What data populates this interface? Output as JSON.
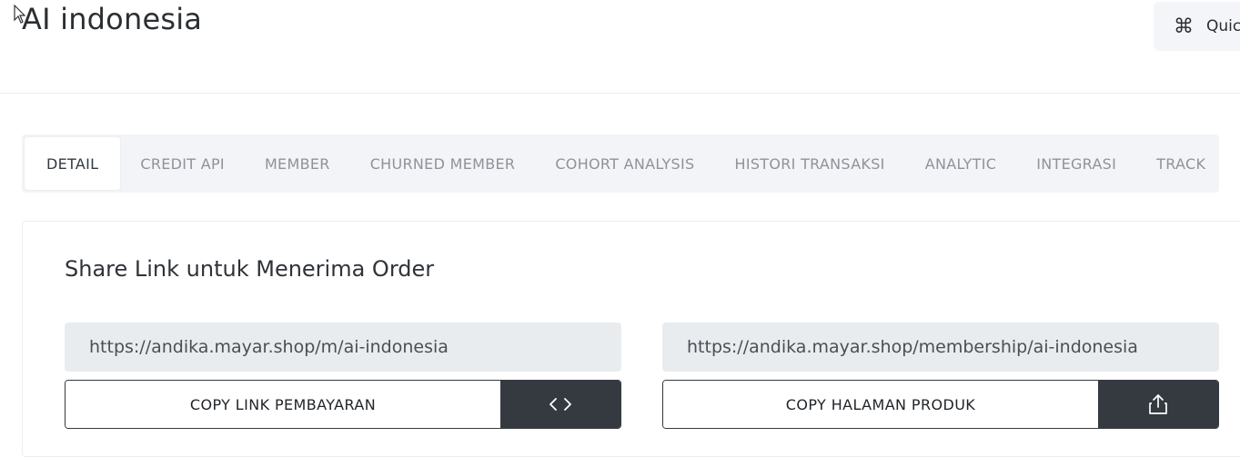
{
  "header": {
    "title": "AI indonesia",
    "quick_button": {
      "icon": "command-icon",
      "label": "Quic"
    }
  },
  "tabs": [
    {
      "label": "DETAIL",
      "active": true
    },
    {
      "label": "CREDIT API"
    },
    {
      "label": "MEMBER"
    },
    {
      "label": "CHURNED MEMBER"
    },
    {
      "label": "COHORT ANALYSIS"
    },
    {
      "label": "HISTORI TRANSAKSI"
    },
    {
      "label": "ANALYTIC"
    },
    {
      "label": "INTEGRASI"
    },
    {
      "label": "TRACK"
    }
  ],
  "share": {
    "title": "Share Link untuk Menerima Order",
    "payment": {
      "url": "https://andika.mayar.shop/m/ai-indonesia",
      "button_label": "COPY LINK PEMBAYARAN",
      "icon": "code-icon"
    },
    "product": {
      "url": "https://andika.mayar.shop/membership/ai-indonesia",
      "button_label": "COPY HALAMAN PRODUK",
      "icon": "share-icon"
    }
  },
  "colors": {
    "dark_button": "#343a40",
    "url_box": "#e9ecef",
    "tab_bar": "#f3f4f7"
  }
}
